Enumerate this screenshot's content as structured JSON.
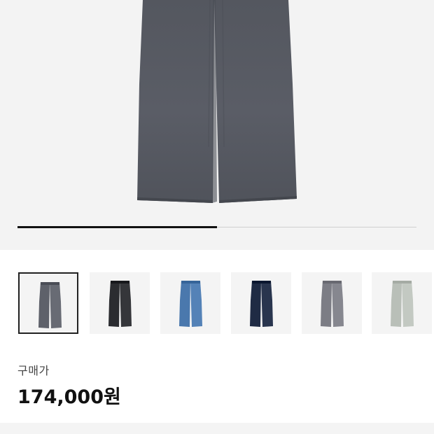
{
  "gallery": {
    "main_image": "charcoal-gray-wide-leg-jeans",
    "main_color": "#5a5d66",
    "progress_fraction": 0.5
  },
  "variants": [
    {
      "name": "charcoal-gray",
      "color": "#5e616a",
      "selected": true
    },
    {
      "name": "black",
      "color": "#2b2c30",
      "selected": false
    },
    {
      "name": "mid-blue",
      "color": "#4a78ad",
      "selected": false
    },
    {
      "name": "dark-navy",
      "color": "#1f2b44",
      "selected": false
    },
    {
      "name": "light-gray",
      "color": "#7c7d85",
      "selected": false
    },
    {
      "name": "pale-gray",
      "color": "#b9bfb8",
      "selected": false
    }
  ],
  "price": {
    "label": "구매가",
    "value": "174,000원"
  }
}
